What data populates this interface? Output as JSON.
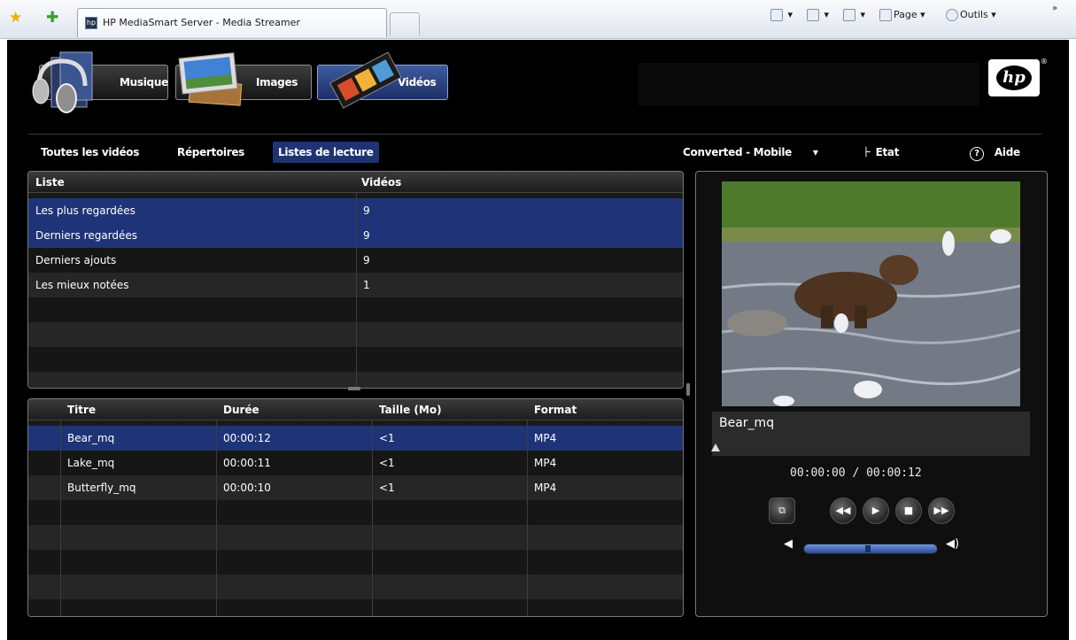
{
  "browser": {
    "tab_title": "HP MediaSmart Server - Media Streamer",
    "tab_icon_label": "hp",
    "page_label": "Page",
    "tools_label": "Outils",
    "overflow": "»"
  },
  "brand": {
    "logo": "hp",
    "reg": "®"
  },
  "nav": {
    "music": "Musique",
    "images": "Images",
    "videos": "Vidéos"
  },
  "subnav": {
    "all": "Toutes les vidéos",
    "folders": "Répertoires",
    "playlists": "Listes de lecture"
  },
  "tools": {
    "profile": "Converted - Mobile",
    "status": "Etat",
    "help": "Aide",
    "help_symbol": "?"
  },
  "playlists": {
    "headers": {
      "list": "Liste",
      "videos": "Vidéos"
    },
    "rows": [
      {
        "name": "Les plus regardées",
        "count": "9"
      },
      {
        "name": "Derniers regardées",
        "count": "9"
      },
      {
        "name": "Derniers ajouts",
        "count": "9"
      },
      {
        "name": "Les mieux notées",
        "count": "1"
      }
    ]
  },
  "videos": {
    "headers": {
      "title": "Titre",
      "duration": "Durée",
      "size": "Taille (Mo)",
      "format": "Format"
    },
    "rows": [
      {
        "title": "Bear_mq",
        "duration": "00:00:12",
        "size": "<1",
        "format": "MP4"
      },
      {
        "title": "Lake_mq",
        "duration": "00:00:11",
        "size": "<1",
        "format": "MP4"
      },
      {
        "title": "Butterfly_mq",
        "duration": "00:00:10",
        "size": "<1",
        "format": "MP4"
      }
    ]
  },
  "player": {
    "now_playing": "Bear_mq",
    "time": "00:00:00  /  00:00:12",
    "volume": 0.5
  },
  "colors": {
    "selection": "#1f3478",
    "active_tab": "#1f3374",
    "background": "#000000"
  }
}
